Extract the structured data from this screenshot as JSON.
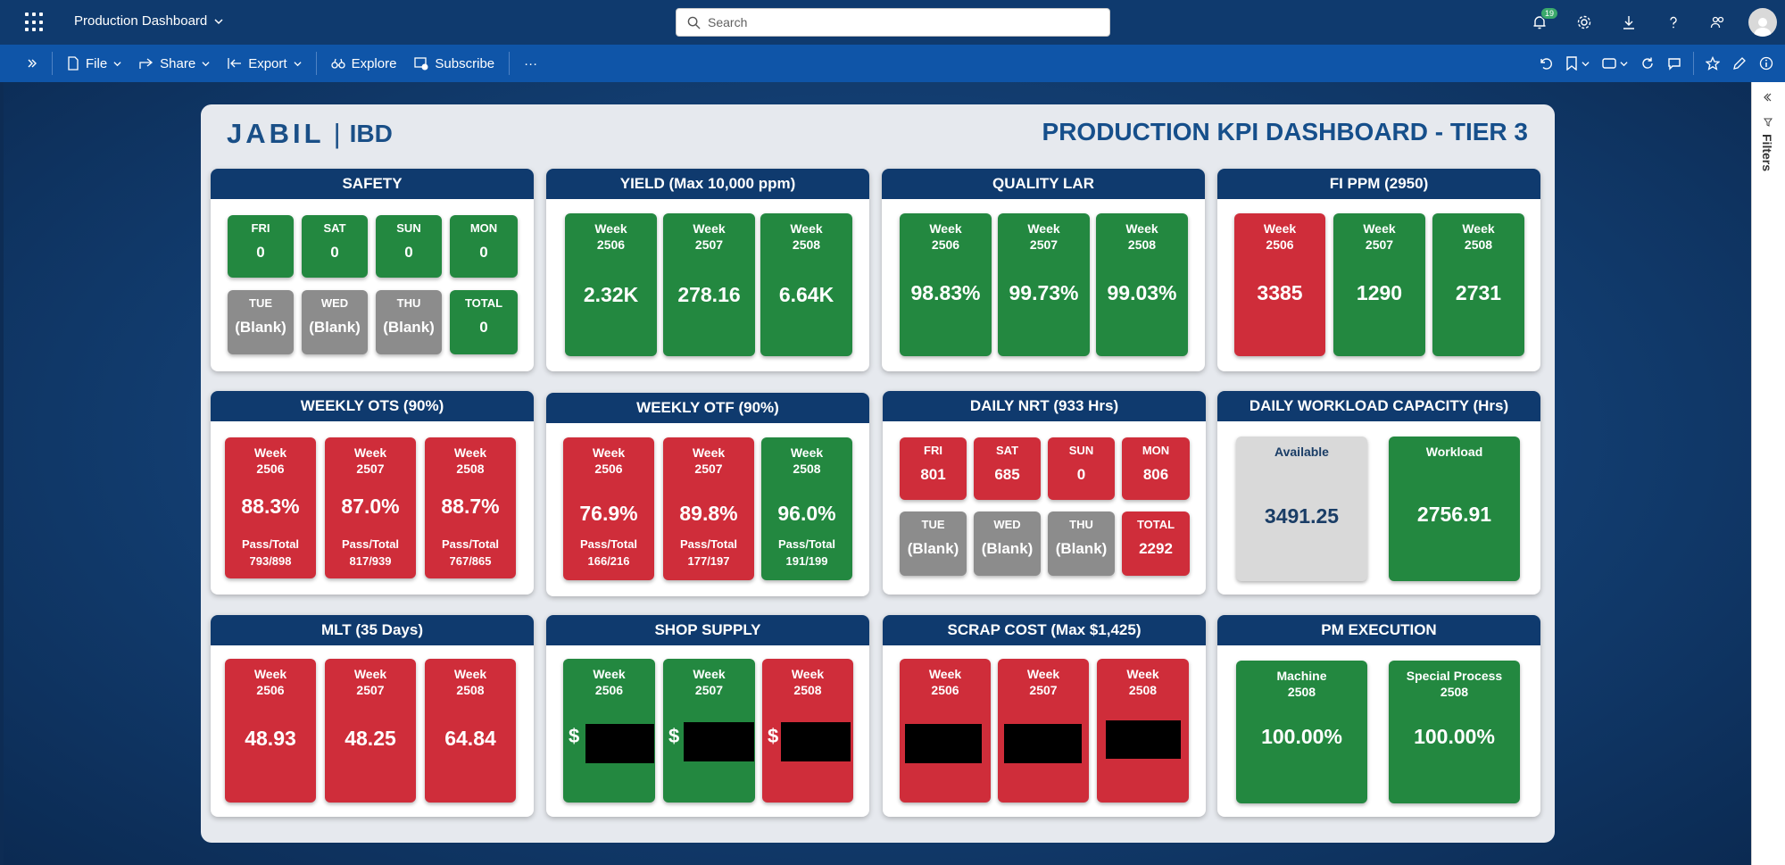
{
  "app": {
    "title": "Production Dashboard"
  },
  "search": {
    "placeholder": "Search"
  },
  "header": {
    "notifications": "19"
  },
  "toolbar": {
    "file": "File",
    "share": "Share",
    "export": "Export",
    "explore": "Explore",
    "subscribe": "Subscribe",
    "more": "···"
  },
  "filters": {
    "label": "Filters"
  },
  "report": {
    "logo_left": "JABIL",
    "logo_sep": "|",
    "logo_right": "IBD",
    "title": "PRODUCTION KPI DASHBOARD - TIER 3"
  },
  "panels": {
    "safety": {
      "title": "SAFETY",
      "tiles": [
        {
          "label": "FRI",
          "value": "0"
        },
        {
          "label": "SAT",
          "value": "0"
        },
        {
          "label": "SUN",
          "value": "0"
        },
        {
          "label": "MON",
          "value": "0"
        },
        {
          "label": "TUE",
          "value": "(Blank)"
        },
        {
          "label": "WED",
          "value": "(Blank)"
        },
        {
          "label": "THU",
          "value": "(Blank)"
        },
        {
          "label": "TOTAL",
          "value": "0"
        }
      ]
    },
    "yield": {
      "title": "YIELD (Max 10,000 ppm)",
      "tiles": [
        {
          "label": "Week",
          "week": "2506",
          "value": "2.32K"
        },
        {
          "label": "Week",
          "week": "2507",
          "value": "278.16"
        },
        {
          "label": "Week",
          "week": "2508",
          "value": "6.64K"
        }
      ]
    },
    "quality_lar": {
      "title": "QUALITY LAR",
      "tiles": [
        {
          "label": "Week",
          "week": "2506",
          "value": "98.83%"
        },
        {
          "label": "Week",
          "week": "2507",
          "value": "99.73%"
        },
        {
          "label": "Week",
          "week": "2508",
          "value": "99.03%"
        }
      ]
    },
    "fi_ppm": {
      "title": "FI PPM (2950)",
      "tiles": [
        {
          "label": "Week",
          "week": "2506",
          "value": "3385"
        },
        {
          "label": "Week",
          "week": "2507",
          "value": "1290"
        },
        {
          "label": "Week",
          "week": "2508",
          "value": "2731"
        }
      ]
    },
    "weekly_ots": {
      "title": "WEEKLY OTS (90%)",
      "tiles": [
        {
          "label": "Week",
          "week": "2506",
          "value": "88.3%",
          "pass_label": "Pass/Total",
          "pass": "793/898"
        },
        {
          "label": "Week",
          "week": "2507",
          "value": "87.0%",
          "pass_label": "Pass/Total",
          "pass": "817/939"
        },
        {
          "label": "Week",
          "week": "2508",
          "value": "88.7%",
          "pass_label": "Pass/Total",
          "pass": "767/865"
        }
      ]
    },
    "weekly_otf": {
      "title": "WEEKLY OTF (90%)",
      "tiles": [
        {
          "label": "Week",
          "week": "2506",
          "value": "76.9%",
          "pass_label": "Pass/Total",
          "pass": "166/216"
        },
        {
          "label": "Week",
          "week": "2507",
          "value": "89.8%",
          "pass_label": "Pass/Total",
          "pass": "177/197"
        },
        {
          "label": "Week",
          "week": "2508",
          "value": "96.0%",
          "pass_label": "Pass/Total",
          "pass": "191/199"
        }
      ]
    },
    "daily_nrt": {
      "title": "DAILY NRT (933 Hrs)",
      "tiles": [
        {
          "label": "FRI",
          "value": "801"
        },
        {
          "label": "SAT",
          "value": "685"
        },
        {
          "label": "SUN",
          "value": "0"
        },
        {
          "label": "MON",
          "value": "806"
        },
        {
          "label": "TUE",
          "value": "(Blank)"
        },
        {
          "label": "WED",
          "value": "(Blank)"
        },
        {
          "label": "THU",
          "value": "(Blank)"
        },
        {
          "label": "TOTAL",
          "value": "2292"
        }
      ]
    },
    "workload": {
      "title": "DAILY WORKLOAD CAPACITY (Hrs)",
      "tiles": [
        {
          "label": "Available",
          "value": "3491.25"
        },
        {
          "label": "Workload",
          "value": "2756.91"
        }
      ]
    },
    "mlt": {
      "title": "MLT (35 Days)",
      "tiles": [
        {
          "label": "Week",
          "week": "2506",
          "value": "48.93"
        },
        {
          "label": "Week",
          "week": "2507",
          "value": "48.25"
        },
        {
          "label": "Week",
          "week": "2508",
          "value": "64.84"
        }
      ]
    },
    "shop_supply": {
      "title": "SHOP SUPPLY",
      "currency": "$",
      "tiles": [
        {
          "label": "Week",
          "week": "2506"
        },
        {
          "label": "Week",
          "week": "2507"
        },
        {
          "label": "Week",
          "week": "2508"
        }
      ]
    },
    "scrap_cost": {
      "title": "SCRAP COST (Max $1,425)",
      "tiles": [
        {
          "label": "Week",
          "week": "2506"
        },
        {
          "label": "Week",
          "week": "2507"
        },
        {
          "label": "Week",
          "week": "2508"
        }
      ]
    },
    "pm_execution": {
      "title": "PM EXECUTION",
      "tiles": [
        {
          "label": "Machine",
          "week": "2508",
          "value": "100.00%"
        },
        {
          "label": "Special Process",
          "week": "2508",
          "value": "100.00%"
        }
      ]
    }
  }
}
